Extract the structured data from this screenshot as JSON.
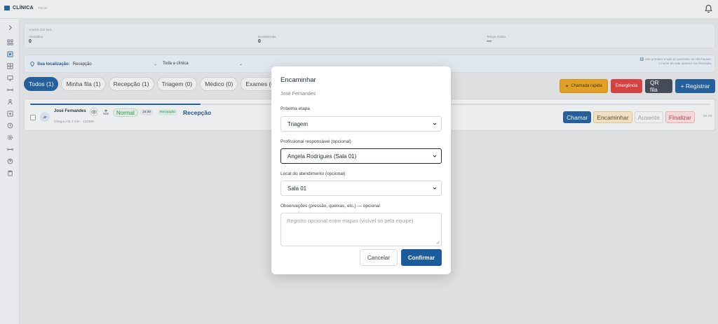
{
  "header": {
    "brand": "CLÍNICA",
    "brand_sub": "Painel",
    "notifications_icon": "bell-icon"
  },
  "sidebar": {
    "toggle_icon": "chevron-right-icon",
    "items": [
      {
        "icon": "grid-icon",
        "active": false
      },
      {
        "icon": "list-icon",
        "active": true
      },
      {
        "icon": "grid-small-icon",
        "active": false
      },
      {
        "icon": "monitor-icon",
        "active": false
      },
      {
        "icon": "tools-icon",
        "active": false
      },
      {
        "icon": "user-icon",
        "active": false
      },
      {
        "icon": "plus-square-icon",
        "active": false
      },
      {
        "icon": "clock-icon",
        "active": false
      },
      {
        "icon": "gear-icon",
        "active": false
      },
      {
        "icon": "arrows-icon",
        "active": false
      },
      {
        "icon": "help-icon",
        "active": false
      },
      {
        "icon": "clipboard-icon",
        "active": false
      }
    ]
  },
  "summary": {
    "title": "VISÃO DO DIA",
    "stats": [
      {
        "label": "Atendidos",
        "value": "0"
      },
      {
        "label": "Desistências",
        "value": "0"
      },
      {
        "label": "Tempo médio",
        "value": "—"
      }
    ]
  },
  "filters": {
    "location_label": "Sua localização:",
    "location_value": "Recepção",
    "scope_value": "Toda a clínica",
    "note": "ℹ️ Use primeiro a sala do paciente; se não houver, o nome da sala aparece na chamada."
  },
  "tabs": [
    {
      "label": "Todos (1)",
      "active": true
    },
    {
      "label": "Minha fila (1)",
      "active": false
    },
    {
      "label": "Recepção (1)",
      "active": false
    },
    {
      "label": "Triagem (0)",
      "active": false
    },
    {
      "label": "Médico (0)",
      "active": false
    },
    {
      "label": "Exames (0)",
      "active": false
    }
  ],
  "actions": {
    "quick_call": "Chamada rápida",
    "emergency": "Emergência",
    "qr": "QR fila",
    "register": "+ Registrar"
  },
  "queue": {
    "progress": 0.25,
    "rows": [
      {
        "initials": "JF",
        "name": "José Fernandes",
        "meta": "Chegou há 2 min · 123456",
        "priority": "Normal",
        "time": "15:30",
        "stage_badge": "Recepção",
        "stage": "Recepção",
        "buttons": {
          "call": "Chamar",
          "forward": "Encaminhar",
          "absent": "Ausente",
          "finish": "Finalizar"
        },
        "elapsed": "02:19"
      }
    ]
  },
  "modal": {
    "title": "Encaminhar",
    "patient": "José Fernandes",
    "next_stage_label": "Próxima etapa",
    "next_stage_value": "Triagem",
    "professional_label": "Profissional responsável (opcional)",
    "professional_value": "Angela Rodrigues (Sala 01)",
    "location_label": "Local do atendimento (opcional)",
    "location_value": "Sala 01",
    "notes_label": "Observações (pressão, queixas, etc.) — opcional",
    "notes_placeholder": "Registro opcional entre etapas (visível só pela equipe)",
    "cancel": "Cancelar",
    "confirm": "Confirmar"
  }
}
